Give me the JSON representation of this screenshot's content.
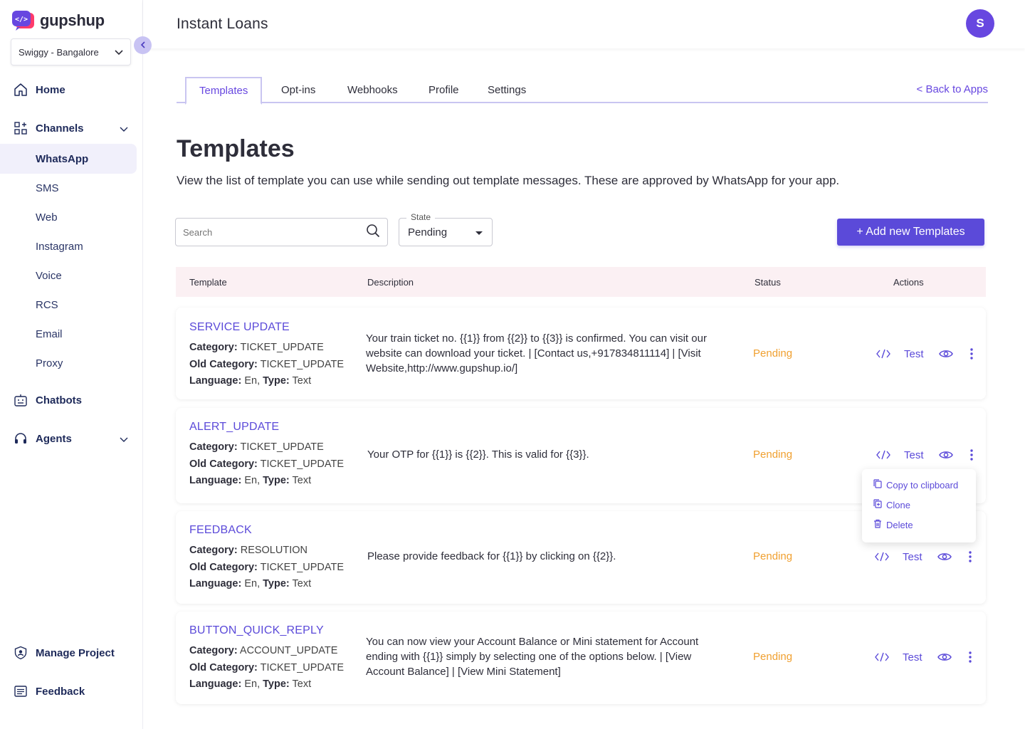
{
  "brand": {
    "name": "gupshup"
  },
  "project": {
    "selected": "Swiggy - Bangalore"
  },
  "sidebar": {
    "items": [
      {
        "label": "Home"
      },
      {
        "label": "Channels"
      },
      {
        "label": "Chatbots"
      },
      {
        "label": "Agents"
      },
      {
        "label": "Manage Project"
      },
      {
        "label": "Feedback"
      }
    ],
    "channels": [
      "WhatsApp",
      "SMS",
      "Web",
      "Instagram",
      "Voice",
      "RCS",
      "Email",
      "Proxy"
    ]
  },
  "header": {
    "title": "Instant Loans",
    "avatar_initial": "S"
  },
  "tabs": {
    "items": [
      "Templates",
      "Opt-ins",
      "Webhooks",
      "Profile",
      "Settings"
    ],
    "back_label": "< Back to Apps"
  },
  "page": {
    "title": "Templates",
    "description": "View the list of template you can use while sending out template messages. These are approved by WhatsApp for your app."
  },
  "filters": {
    "search_placeholder": "Search",
    "state_label": "State",
    "state_value": "Pending",
    "add_button": "+ Add new Templates"
  },
  "table": {
    "headers": [
      "Template",
      "Description",
      "Status",
      "Actions"
    ],
    "labels": {
      "category": "Category:",
      "old_category": "Old Category:",
      "language": "Language:",
      "type": "Type:",
      "test": "Test"
    },
    "rows": [
      {
        "name": "SERVICE UPDATE",
        "category": "TICKET_UPDATE",
        "old_category": "TICKET_UPDATE",
        "language": "En,",
        "type": "Text",
        "description": "Your train ticket no. {{1}} from {{2}} to {{3}} is confirmed. You can visit our website can download your ticket. | [Contact us,+917834811114] | [Visit Website,http://www.gupshup.io/]",
        "status": "Pending"
      },
      {
        "name": "ALERT_UPDATE",
        "category": "TICKET_UPDATE",
        "old_category": "TICKET_UPDATE",
        "language": "En,",
        "type": "Text",
        "description": "Your OTP for {{1}} is {{2}}. This is valid for {{3}}.",
        "status": "Pending"
      },
      {
        "name": "FEEDBACK",
        "category": "RESOLUTION",
        "old_category": "TICKET_UPDATE",
        "language": "En,",
        "type": "Text",
        "description": "Please provide feedback for {{1}} by clicking on {{2}}.",
        "status": "Pending"
      },
      {
        "name": "BUTTON_QUICK_REPLY",
        "category": "ACCOUNT_UPDATE",
        "old_category": "TICKET_UPDATE",
        "language": "En,",
        "type": "Text",
        "description": "You can now view your Account Balance or Mini statement for Account ending with {{1}} simply by selecting one of the options below. | [View Account Balance] | [View Mini Statement]",
        "status": "Pending"
      }
    ]
  },
  "menu": {
    "items": [
      "Copy to clipboard",
      "Clone",
      "Delete"
    ]
  },
  "colors": {
    "accent": "#5b4ad9",
    "pending": "#f0a030",
    "header_row": "#fbf0f3"
  }
}
